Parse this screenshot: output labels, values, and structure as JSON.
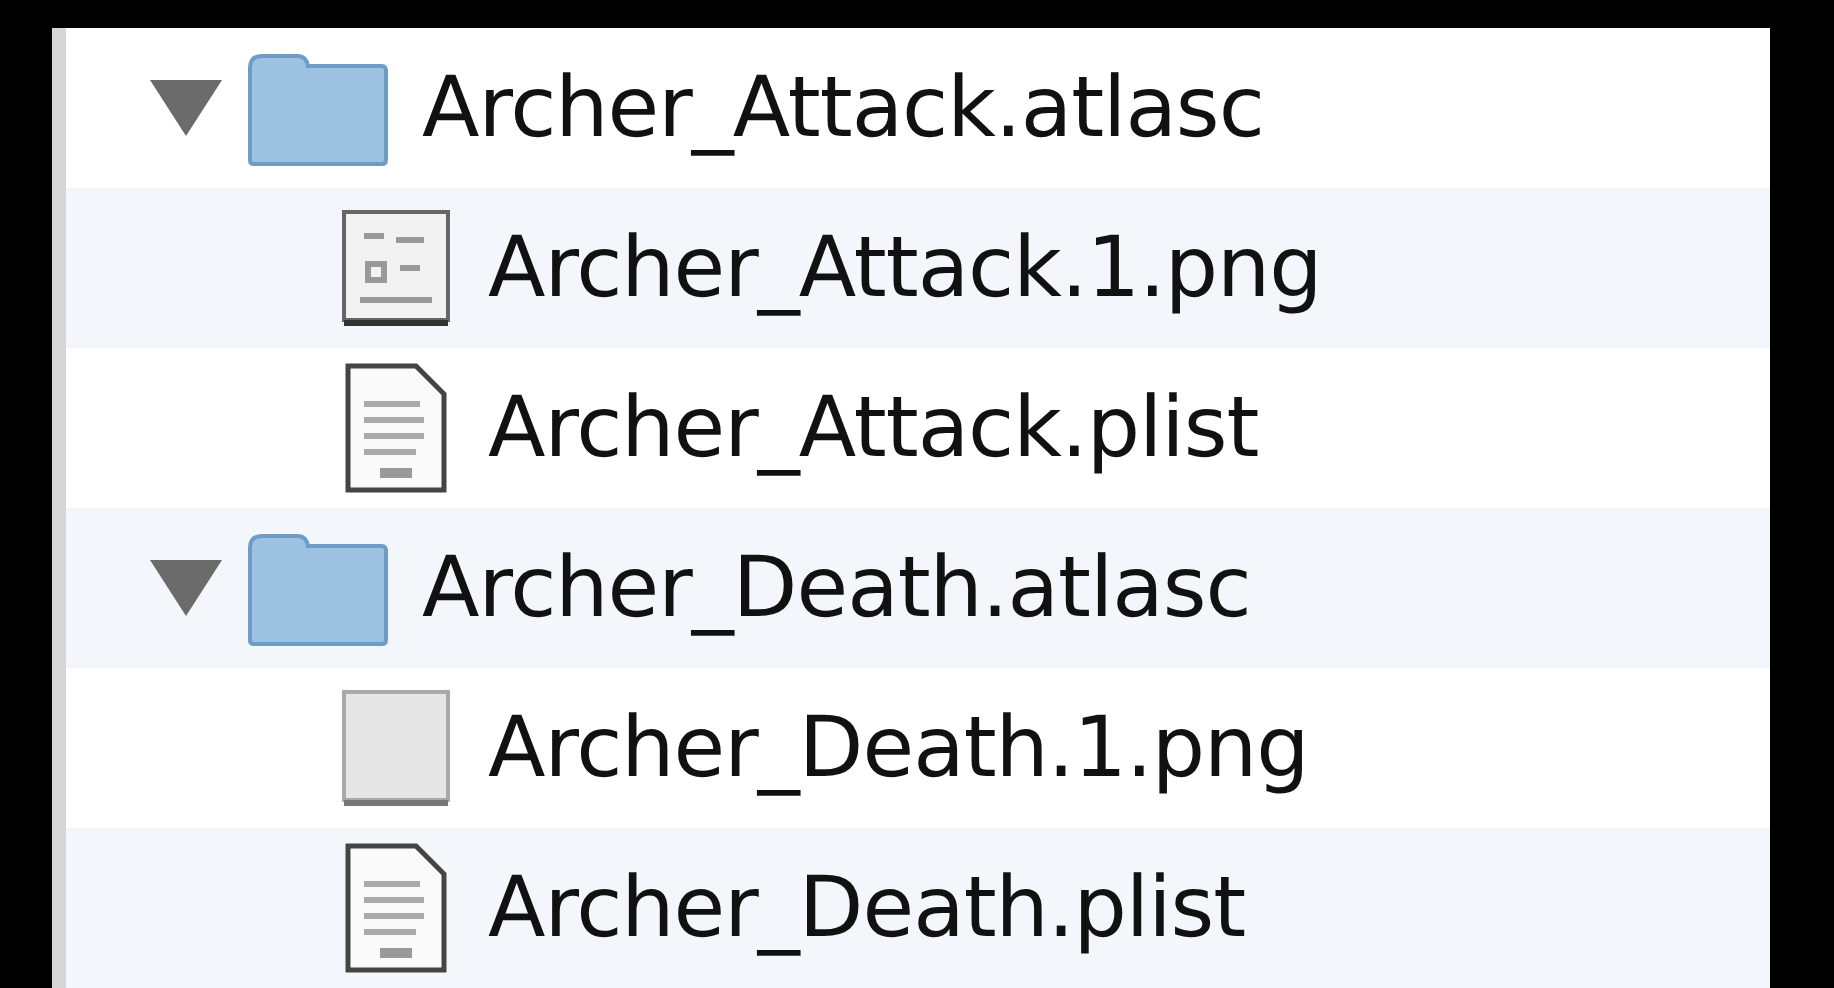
{
  "tree": [
    {
      "kind": "folder",
      "name": "Archer_Attack.atlasc",
      "expanded": true,
      "children": [
        {
          "kind": "image",
          "name": "Archer_Attack.1.png"
        },
        {
          "kind": "plist",
          "name": "Archer_Attack.plist"
        }
      ]
    },
    {
      "kind": "folder",
      "name": "Archer_Death.atlasc",
      "expanded": true,
      "children": [
        {
          "kind": "blank-image",
          "name": "Archer_Death.1.png"
        },
        {
          "kind": "plist",
          "name": "Archer_Death.plist"
        }
      ]
    }
  ]
}
